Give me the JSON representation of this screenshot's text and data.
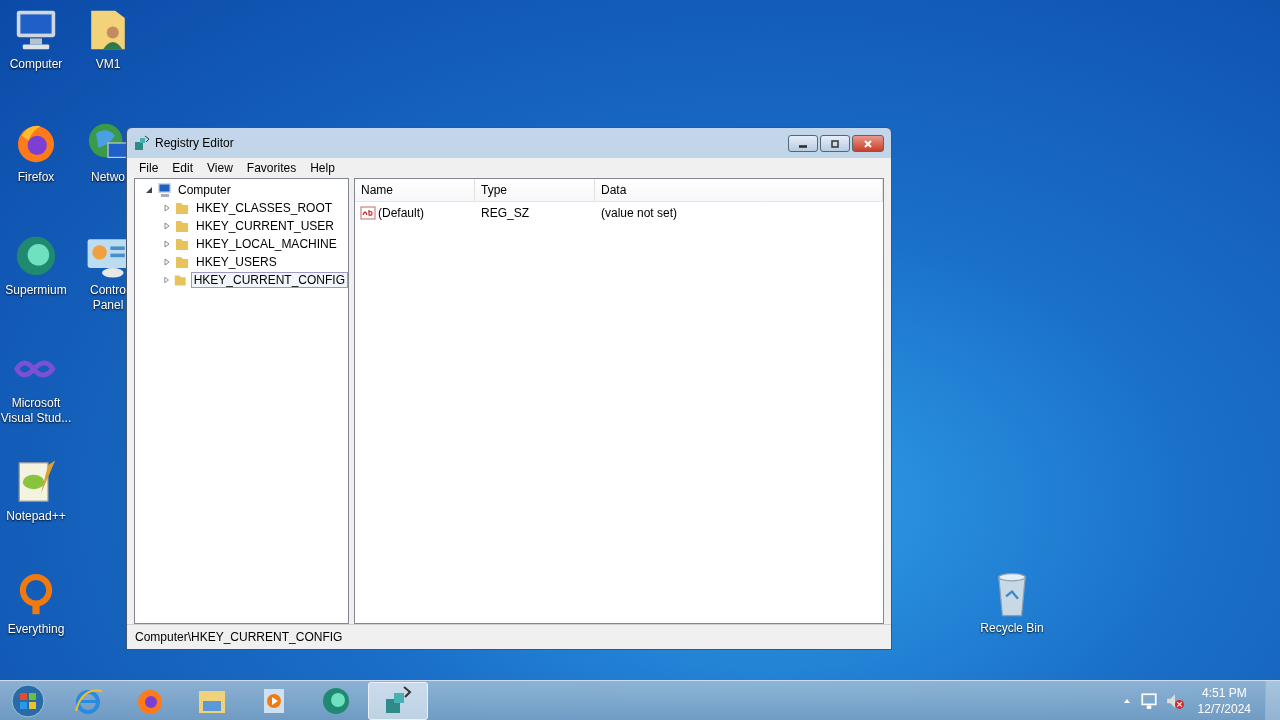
{
  "desktop_icons": [
    {
      "label": "Computer",
      "kind": "computer"
    },
    {
      "label": "Firefox",
      "kind": "firefox"
    },
    {
      "label": "Supermium",
      "kind": "supermium"
    },
    {
      "label": "Microsoft\nVisual Stud...",
      "kind": "vs"
    },
    {
      "label": "Notepad++",
      "kind": "notepad"
    },
    {
      "label": "Everything",
      "kind": "everything"
    },
    {
      "label": "VM1",
      "kind": "userfolder"
    },
    {
      "label": "Netwo",
      "kind": "network"
    },
    {
      "label": "Contro\nPanel",
      "kind": "controlpanel"
    }
  ],
  "recycle_bin": {
    "label": "Recycle Bin"
  },
  "window": {
    "title": "Registry Editor",
    "menu": [
      "File",
      "Edit",
      "View",
      "Favorites",
      "Help"
    ],
    "tree": [
      {
        "label": "Computer",
        "expanded": true,
        "selected": false,
        "children": [
          {
            "label": "HKEY_CLASSES_ROOT",
            "expanded": false,
            "selected": false
          },
          {
            "label": "HKEY_CURRENT_USER",
            "expanded": false,
            "selected": false
          },
          {
            "label": "HKEY_LOCAL_MACHINE",
            "expanded": false,
            "selected": false
          },
          {
            "label": "HKEY_USERS",
            "expanded": false,
            "selected": false
          },
          {
            "label": "HKEY_CURRENT_CONFIG",
            "expanded": false,
            "selected": true
          }
        ]
      }
    ],
    "table": {
      "columns": [
        "Name",
        "Type",
        "Data"
      ],
      "rows": [
        {
          "name": "(Default)",
          "type": "REG_SZ",
          "data": "(value not set)"
        }
      ]
    },
    "status_bar": "Computer\\HKEY_CURRENT_CONFIG"
  },
  "taskbar": {
    "items": [
      {
        "kind": "ie",
        "selected": false
      },
      {
        "kind": "firefox",
        "selected": false
      },
      {
        "kind": "explorer",
        "selected": false
      },
      {
        "kind": "media",
        "selected": false
      },
      {
        "kind": "supermium",
        "selected": false
      },
      {
        "kind": "regedit",
        "selected": true
      }
    ],
    "time": "4:51 PM",
    "date": "12/7/2024"
  }
}
